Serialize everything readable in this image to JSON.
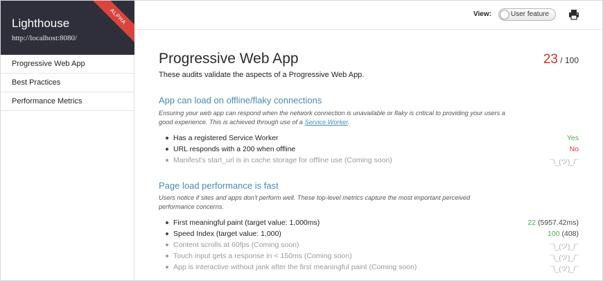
{
  "sidebar": {
    "title": "Lighthouse",
    "url": "http://localhost:8080/",
    "badge": "ALPHA",
    "items": [
      {
        "label": "Progressive Web App"
      },
      {
        "label": "Best Practices"
      },
      {
        "label": "Performance Metrics"
      }
    ]
  },
  "topbar": {
    "view_label": "View:",
    "toggle_label": "User feature"
  },
  "main": {
    "title": "Progressive Web App",
    "subtitle": "These audits validate the aspects of a Progressive Web App.",
    "score": "23",
    "score_total": "/ 100",
    "sections": [
      {
        "title": "App can load on offline/flaky connections",
        "description": "Ensuring your web app can respond when the network connection is unavailable or flaky is critical to providing your users a good experience. This is achieved through use of a",
        "link": "Service Worker",
        "description_end": ".",
        "audits": [
          {
            "label": "Has a registered Service Worker",
            "result": "Yes"
          },
          {
            "label": "URL responds with a 200 when offline",
            "result": "No"
          },
          {
            "label": "Manifest's start_url is in cache storage for offline use (Coming soon)",
            "result": "¯\\_(ツ)_/¯"
          }
        ]
      },
      {
        "title": "Page load performance is fast",
        "description": "Users notice if sites and apps don't perform well. These top-level metrics capture the most important perceived performance concerns.",
        "audits": [
          {
            "label": "First meaningful paint (target value: 1,000ms)",
            "score": "22",
            "detail": "(5957.42ms)"
          },
          {
            "label": "Speed Index (target value: 1,000)",
            "score": "100",
            "detail": "(408)"
          },
          {
            "label": "Content scrolls at 60fps (Coming soon)",
            "result": "¯\\_(ツ)_/¯"
          },
          {
            "label": "Touch input gets a response in < 150ms (Coming soon)",
            "result": "¯\\_(ツ)_/¯"
          },
          {
            "label": "App is interactive without jank after the first meaningful paint (Coming soon)",
            "result": "¯\\_(ツ)_/¯"
          }
        ]
      }
    ]
  },
  "colors": {
    "sidebar_header": "#2e2f3a",
    "badge": "#d9453d",
    "section_title": "#4b8bb5",
    "score": "#d32f2f",
    "pass": "#4caf50",
    "fail": "#e53935"
  }
}
